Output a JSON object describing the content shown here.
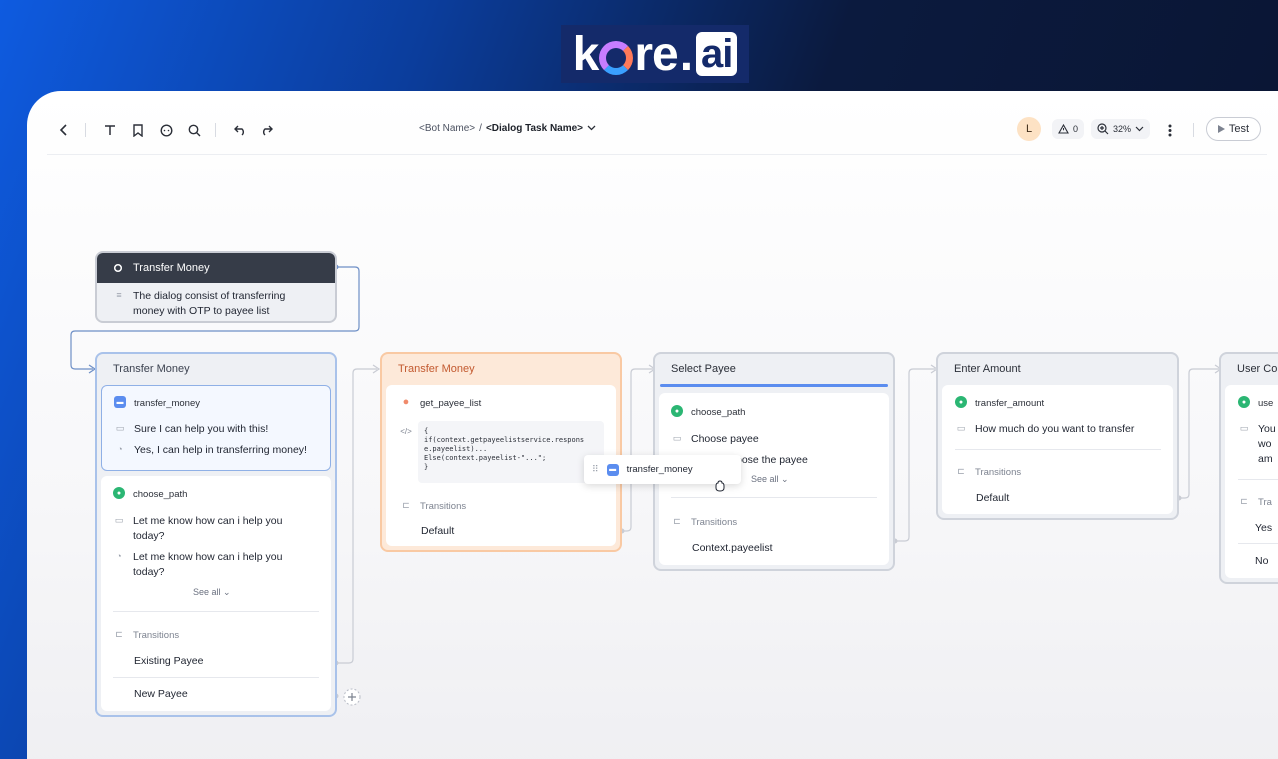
{
  "brand": {
    "logo_k": "k",
    "logo_re": "re",
    "logo_dot": ".",
    "logo_ai": "ai"
  },
  "toolbar": {
    "bot_name": "<Bot Name>",
    "separator": "/",
    "dialog_task_name": "<Dialog Task Name>",
    "avatar_initial": "L",
    "warnings_count": "0",
    "zoom_level": "32%",
    "test_label": "Test",
    "icons": [
      "back-icon",
      "text-icon",
      "bookmark-icon",
      "chat-icon",
      "search-icon",
      "undo-icon",
      "redo-icon"
    ]
  },
  "canvas": {
    "start_node": {
      "title": "Transfer Money",
      "description_line1": "The dialog consist of transferring",
      "description_line2": "money with OTP to payee list"
    },
    "node1": {
      "title": "Transfer Money",
      "intent": {
        "name": "transfer_money",
        "msg1": "Sure I can help you with this!",
        "msg2": "Yes, I can help in transferring money!"
      },
      "choose": {
        "name": "choose_path",
        "msg1_a": "Let me know how can i help you",
        "msg1_b": "today?",
        "msg2_a": "Let me know how can i help you",
        "msg2_b": "today?",
        "see_all": "See all"
      },
      "transitions_label": "Transitions",
      "transitions": [
        "Existing Payee",
        "New Payee"
      ]
    },
    "node2": {
      "title": "Transfer Money",
      "service": "get_payee_list",
      "code_line1": "{",
      "code_line2": "if(context.getpayeelistservice.respons",
      "code_line3": "e.payeelist)...",
      "code_line4": "Else(context.payeelist-\"...\";",
      "code_line5": "}",
      "transitions_label": "Transitions",
      "transitions": [
        "Default"
      ]
    },
    "drag_chip": {
      "label": "transfer_money"
    },
    "node3": {
      "title": "Select Payee",
      "name": "choose_path",
      "msg1": "Choose payee",
      "msg2": "oose the payee",
      "see_all": "See all",
      "transitions_label": "Transitions",
      "transitions": [
        "Context.payeelist"
      ]
    },
    "node4": {
      "title": "Enter Amount",
      "name": "transfer_amount",
      "msg1": "How much do you want to transfer",
      "transitions_label": "Transitions",
      "transitions": [
        "Default"
      ]
    },
    "node5": {
      "title": "User Co",
      "name": "use",
      "msg1_a": "You",
      "msg1_b": "wo",
      "msg1_c": "am",
      "transitions_label": "Tra",
      "transitions": [
        "Yes",
        "No"
      ]
    }
  }
}
